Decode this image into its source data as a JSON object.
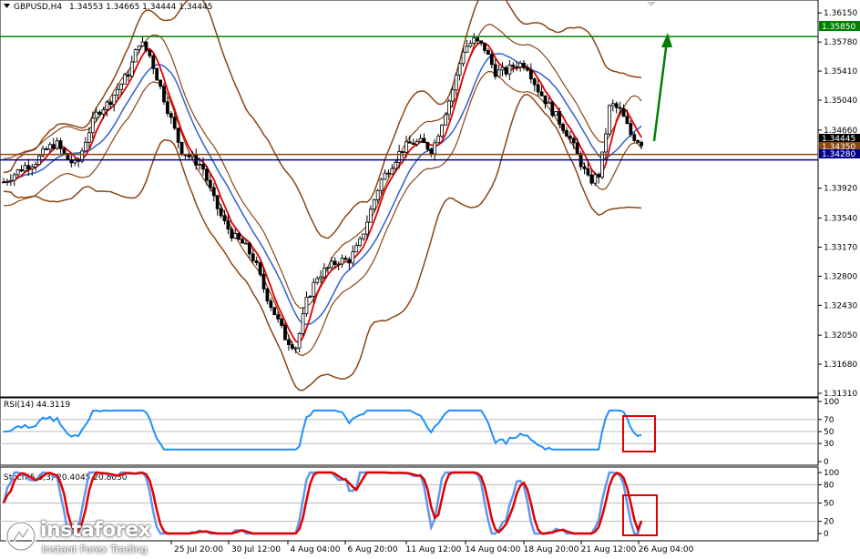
{
  "header": {
    "symbol": "GBPUSD,H4",
    "ohlc": "1.34553 1.34665 1.34444 1.34445"
  },
  "rsi_label": "RSI(14) 44.3119",
  "stoch_label": "Stoch(5,3,3) 20.4045 20.8030",
  "price_axis": [
    "1.36150",
    "1.35780",
    "1.35410",
    "1.35040",
    "1.34660",
    "1.33920",
    "1.33540",
    "1.33170",
    "1.32800",
    "1.32430",
    "1.32050",
    "1.31680",
    "1.31310"
  ],
  "price_tags": {
    "current": "1.34445",
    "level_green": "1.35850",
    "level_brown": "1.34350",
    "level_blue": "1.34280"
  },
  "rsi_axis": [
    "100",
    "70",
    "50",
    "30",
    "0"
  ],
  "stoch_axis": [
    "100",
    "80",
    "50",
    "20",
    "0"
  ],
  "time_axis": [
    "25 Jul 20:00",
    "30 Jul 12:00",
    "4 Aug 04:00",
    "6 Aug 20:00",
    "11 Aug 12:00",
    "14 Aug 04:00",
    "18 Aug 20:00",
    "21 Aug 12:00",
    "26 Aug 04:00"
  ],
  "logo": {
    "brand": "instaforex",
    "tagline": "Instant Forex Trading"
  },
  "colors": {
    "green_level": "#008000",
    "brown_level": "#8b4513",
    "blue_level": "#00008b",
    "bollinger": "#8b4513",
    "fast_ma": "#e00000",
    "slow_ma": "#3060d0",
    "rsi_line": "#1e90ff",
    "stoch_main": "#6495ed",
    "stoch_signal": "#e00000",
    "highlight_box": "#e00000",
    "arrow": "#008000"
  },
  "chart_data": {
    "type": "candlestick",
    "symbol": "GBPUSD",
    "timeframe": "H4",
    "ylim": [
      1.3131,
      1.3628
    ],
    "close_series": [
      1.34,
      1.341,
      1.342,
      1.3425,
      1.344,
      1.345,
      1.343,
      1.342,
      1.346,
      1.349,
      1.35,
      1.352,
      1.354,
      1.358,
      1.356,
      1.352,
      1.348,
      1.344,
      1.343,
      1.342,
      1.338,
      1.335,
      1.333,
      1.332,
      1.33,
      1.326,
      1.323,
      1.32,
      1.319,
      1.325,
      1.328,
      1.329,
      1.33,
      1.33,
      1.332,
      1.336,
      1.34,
      1.342,
      1.344,
      1.345,
      1.345,
      1.344,
      1.348,
      1.352,
      1.357,
      1.358,
      1.357,
      1.354,
      1.354,
      1.355,
      1.355,
      1.352,
      1.35,
      1.348,
      1.346,
      1.343,
      1.34,
      1.341,
      1.35,
      1.349,
      1.346,
      1.345
    ],
    "horizontal_levels": [
      1.3585,
      1.3435,
      1.3428
    ],
    "current_price": 1.34445,
    "rsi": {
      "period": 14,
      "value": 44.3119,
      "levels": [
        70,
        50,
        30
      ],
      "ylim": [
        0,
        100
      ]
    },
    "stochastic": {
      "params": "5,3,3",
      "main": 20.4045,
      "signal": 20.803,
      "levels": [
        80,
        50,
        20
      ],
      "ylim": [
        0,
        100
      ]
    }
  }
}
